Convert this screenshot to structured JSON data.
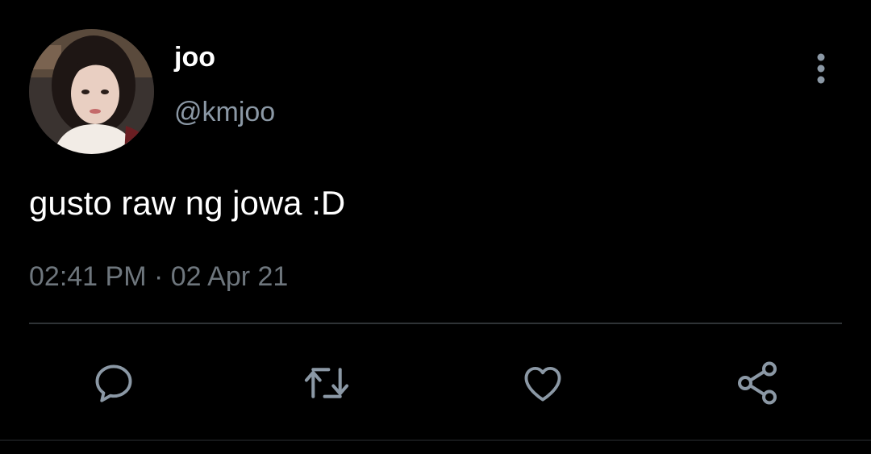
{
  "author": {
    "display_name": "joo",
    "handle": "@kmjoo",
    "avatar_icon": "profile-photo"
  },
  "tweet": {
    "text": "gusto raw ng jowa :D",
    "time": "02:41 PM",
    "separator": "·",
    "date": "02 Apr 21"
  },
  "actions": {
    "reply_icon": "reply-icon",
    "retweet_icon": "retweet-icon",
    "like_icon": "like-icon",
    "share_icon": "share-icon",
    "more_icon": "more-vertical-icon"
  },
  "colors": {
    "background": "#000000",
    "primary_text": "#ffffff",
    "secondary_text": "#8b98a5",
    "icon": "#8b98a5",
    "divider": "#2f3336"
  }
}
